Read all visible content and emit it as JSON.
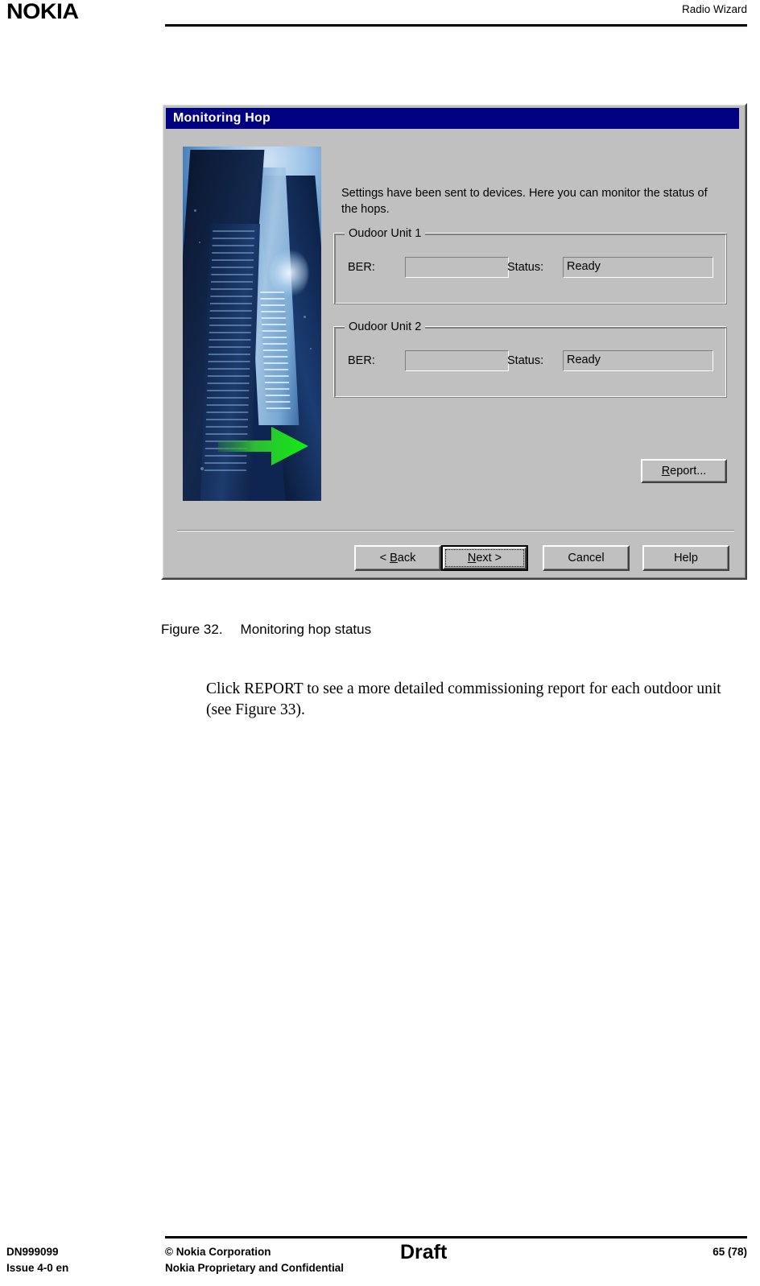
{
  "page": {
    "header": {
      "logo_text": "NOKIA",
      "title": "Radio Wizard"
    },
    "footer": {
      "doc_number": "DN999099",
      "issue": "Issue 4-0 en",
      "copyright": "© Nokia Corporation",
      "confidentiality": "Nokia Proprietary and Confidential",
      "status": "Draft",
      "page_number": "65 (78)"
    },
    "figure_caption": {
      "number": "Figure 32.",
      "title": "Monitoring hop status"
    },
    "body_paragraph": "Click REPORT to see a more detailed commissioning report for each outdoor unit (see Figure 33)."
  },
  "dialog": {
    "title": "Monitoring Hop",
    "intro_text": "Settings have been sent to devices. Here you can monitor the status of the hops.",
    "sidebar_image": {
      "name": "wizard-skyscrapers-illustration",
      "description": "Blue-toned photograph of skyscrapers seen from below with a green arrow pointing right"
    },
    "groups": [
      {
        "legend": "Oudoor Unit 1",
        "ber_label": "BER:",
        "ber_value": "",
        "status_label": "Status:",
        "status_value": "Ready"
      },
      {
        "legend": "Oudoor Unit 2",
        "ber_label": "BER:",
        "ber_value": "",
        "status_label": "Status:",
        "status_value": "Ready"
      }
    ],
    "buttons": {
      "report": "Report...",
      "back": "< Back",
      "next": "Next >",
      "cancel": "Cancel",
      "help": "Help"
    },
    "colors": {
      "titlebar": "#000080",
      "face": "#c0c0c0",
      "arrow_green": "#22dd22"
    }
  }
}
